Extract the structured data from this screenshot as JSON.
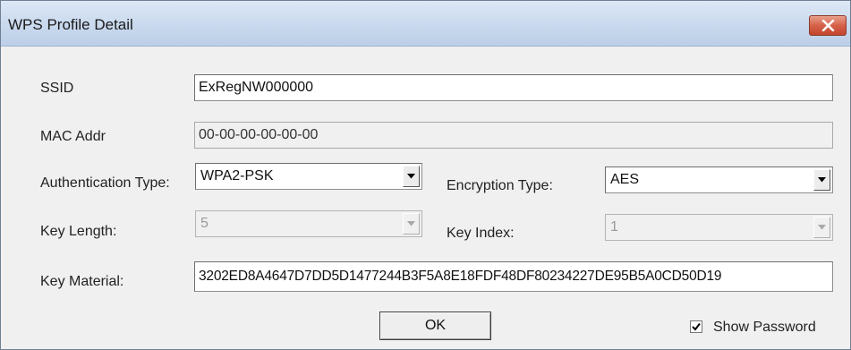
{
  "window": {
    "title": "WPS Profile Detail"
  },
  "ssid": {
    "label": "SSID",
    "value": "ExRegNW000000"
  },
  "mac": {
    "label": "MAC Addr",
    "value": "00-00-00-00-00-00"
  },
  "auth": {
    "label": "Authentication Type:",
    "value": "WPA2-PSK"
  },
  "encryption": {
    "label": "Encryption Type:",
    "value": "AES"
  },
  "key_length": {
    "label": "Key Length:",
    "value": "5"
  },
  "key_index": {
    "label": "Key Index:",
    "value": "1"
  },
  "key_material": {
    "label": "Key Material:",
    "value": "3202ED8A4647D7DD5D1477244B3F5A8E18FDF48DF80234227DE95B5A0CD50D19"
  },
  "buttons": {
    "ok": "OK"
  },
  "show_password": {
    "label": "Show Password",
    "checked": true
  },
  "colors": {
    "titlebar": "#c9d9ee",
    "close_button": "#d6624a",
    "dialog_background": "#f0f0f0"
  },
  "icons": {
    "close": "close-icon",
    "dropdown": "chevron-down-icon",
    "check": "checkmark-icon"
  }
}
